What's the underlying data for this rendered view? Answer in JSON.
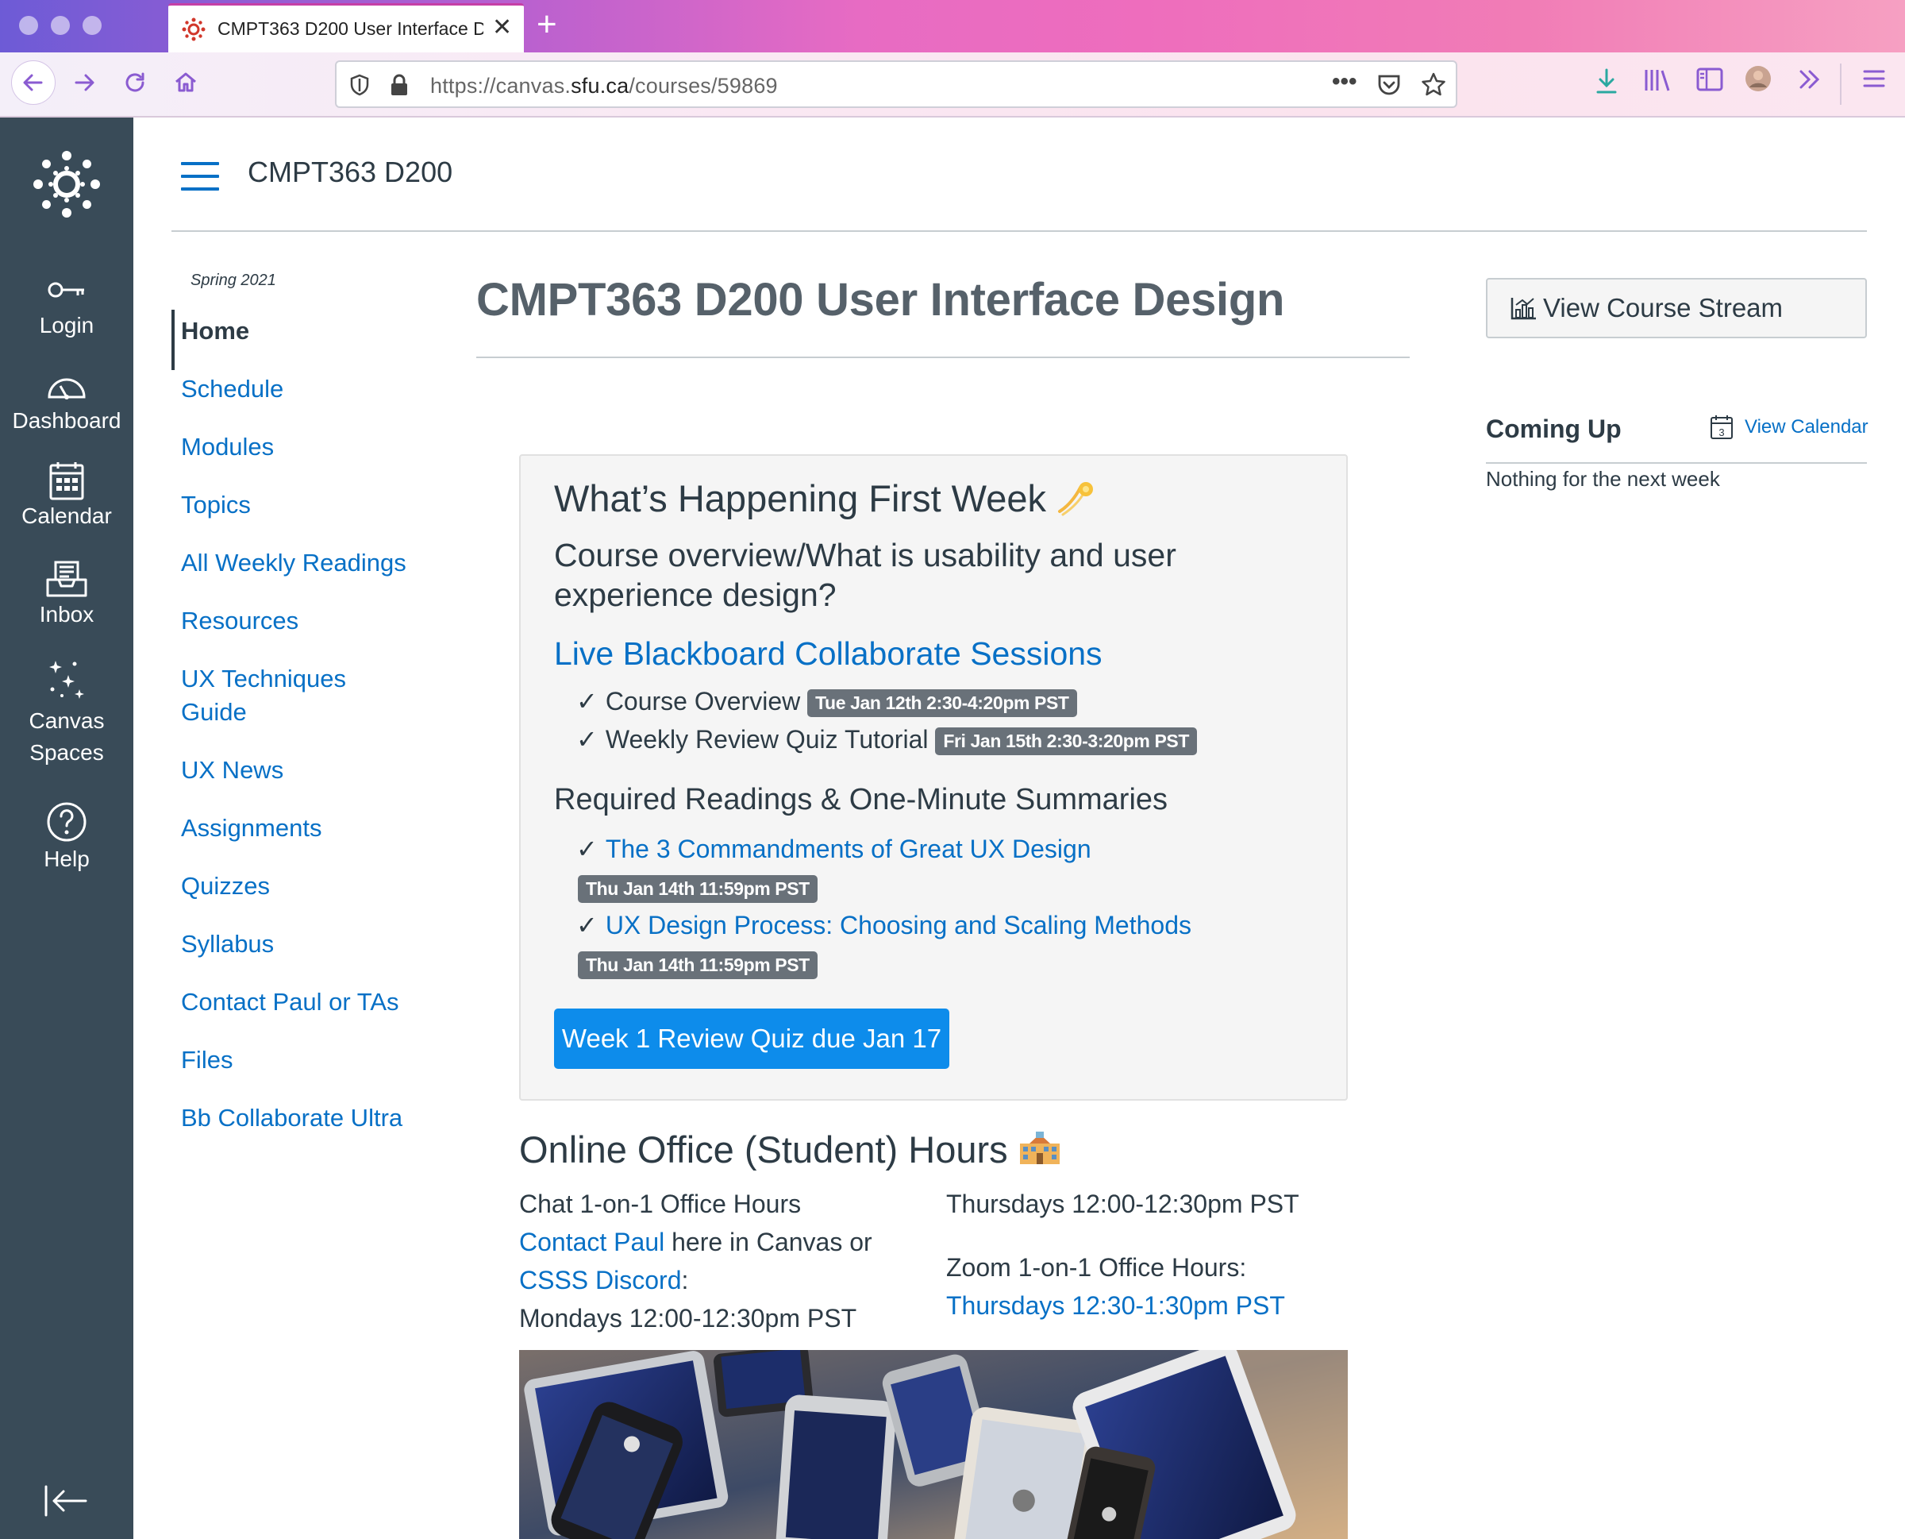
{
  "browser": {
    "tab_title": "CMPT363 D200 User Interface Design",
    "tab_close": "✕",
    "new_tab": "+",
    "url_scheme": "https://canvas.",
    "url_host": "sfu.ca",
    "url_path": "/courses/59869",
    "page_actions": "•••"
  },
  "global_nav": {
    "items": [
      {
        "label": "Login",
        "icon": "key-icon"
      },
      {
        "label": "Dashboard",
        "icon": "speedometer-icon"
      },
      {
        "label": "Calendar",
        "icon": "calendar-icon"
      },
      {
        "label": "Inbox",
        "icon": "inbox-icon"
      },
      {
        "label": "Canvas Spaces",
        "icon": "sparkle-icon"
      },
      {
        "label": "Help",
        "icon": "help-icon"
      }
    ]
  },
  "header": {
    "course_crumb": "CMPT363 D200"
  },
  "course_nav": {
    "term": "Spring 2021",
    "items": [
      "Home",
      "Schedule",
      "Modules",
      "Topics",
      "All Weekly Readings",
      "Resources",
      "UX Techniques Guide",
      "UX News",
      "Assignments",
      "Quizzes",
      "Syllabus",
      "Contact Paul or TAs",
      "Files",
      "Bb Collaborate Ultra"
    ]
  },
  "main": {
    "title": "CMPT363 D200 User Interface Design",
    "week": {
      "heading": "What’s Happening First Week",
      "subheading": "Course overview/What is usability and user experience design?",
      "live_link": "Live Blackboard Collaborate Sessions",
      "sessions": [
        {
          "label": "Course Overview",
          "when": "Tue Jan 12th 2:30-4:20pm PST"
        },
        {
          "label": "Weekly Review Quiz Tutorial",
          "when": "Fri Jan 15th 2:30-3:20pm PST"
        }
      ],
      "readings_heading": "Required Readings & One-Minute Summaries",
      "readings": [
        {
          "label": "The 3 Commandments of Great UX Design",
          "due": "Thu Jan 14th 11:59pm PST"
        },
        {
          "label": "UX Design Process: Choosing and Scaling Methods",
          "due": "Thu Jan 14th 11:59pm PST"
        }
      ],
      "check_mark": "✓",
      "quiz_button": "Week 1 Review Quiz due Jan 17"
    },
    "office": {
      "heading": "Online Office (Student) Hours",
      "chat_label": "Chat 1-on-1 Office Hours",
      "contact_link": "Contact Paul",
      "contact_suffix": " here in Canvas or",
      "discord_link": "CSSS Discord",
      "discord_suffix": ":",
      "mondays": "Mondays 12:00-12:30pm PST",
      "thursdays": "Thursdays 12:00-12:30pm PST",
      "zoom_label": "Zoom 1-on-1 Office Hours:",
      "zoom_link": "Thursdays 12:30-1:30pm PST"
    }
  },
  "sidebar": {
    "stream_button": "View Course Stream",
    "coming_up": "Coming Up",
    "view_calendar": "View Calendar",
    "calendar_day": "3",
    "nothing": "Nothing for the next week"
  },
  "colors": {
    "link": "#0770c6",
    "global_nav_bg": "#394b58",
    "button_primary": "#0d8ceb",
    "badge_bg": "#697179"
  }
}
